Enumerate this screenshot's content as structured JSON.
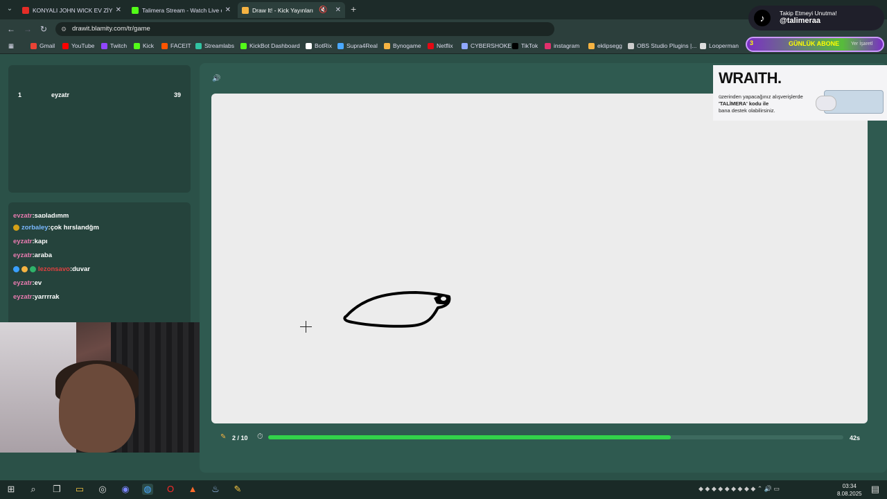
{
  "browser": {
    "tabs": [
      {
        "title": "KONYALI JOHN WICK EV ZİYARETİ",
        "favicon_color": "#e52d27"
      },
      {
        "title": "Talimera Stream - Watch Live on Kick",
        "favicon_color": "#53fc18"
      },
      {
        "title": "Draw It! - Kick Yayınları İçin",
        "favicon_color": "#f5b342"
      }
    ],
    "new_tab": "+",
    "url": "drawit.blamity.com/tr/game",
    "bookmarks": [
      {
        "label": "Gmail",
        "color": "#ea4335"
      },
      {
        "label": "YouTube",
        "color": "#ff0000"
      },
      {
        "label": "Twitch",
        "color": "#9146ff"
      },
      {
        "label": "Kick",
        "color": "#53fc18"
      },
      {
        "label": "FACEIT",
        "color": "#ff5500"
      },
      {
        "label": "Streamlabs",
        "color": "#31c3a2"
      },
      {
        "label": "KickBot Dashboard",
        "color": "#53fc18"
      },
      {
        "label": "BotRix",
        "color": "#ffffff"
      },
      {
        "label": "Supra4Real",
        "color": "#4aa8ff"
      },
      {
        "label": "Bynogame",
        "color": "#f5b342"
      },
      {
        "label": "Netflix",
        "color": "#e50914"
      },
      {
        "label": "CYBERSHOKE",
        "color": "#8fa8ff"
      },
      {
        "label": "TikTok",
        "color": "#000000"
      },
      {
        "label": "instagram",
        "color": "#e1306c"
      },
      {
        "label": "eklipsegg",
        "color": "#f5b342"
      },
      {
        "label": "OBS Studio Plugins |...",
        "color": "#cccccc"
      },
      {
        "label": "Looperman",
        "color": "#dddddd"
      }
    ]
  },
  "overlay": {
    "tiktok_line1": "Takip Etmeyi Unutma!",
    "tiktok_line2": "@talimeraa",
    "abone_count": "3",
    "abone_label": "GÜNLÜK ABONE",
    "abone_sub": "Yer İşaretl"
  },
  "leaderboard": {
    "rows": [
      {
        "rank": "1",
        "name": "eyzatr",
        "score": "39"
      }
    ]
  },
  "chat": {
    "lines": [
      {
        "user": "eyzatr",
        "msg": ":sapladımm",
        "cls": "u"
      },
      {
        "user": "zorbaley",
        "msg": ":çok hırslandğm",
        "cls": "u2"
      },
      {
        "user": "eyzatr",
        "msg": ":kapı",
        "cls": "u"
      },
      {
        "user": "eyzatr",
        "msg": ":araba",
        "cls": "u"
      },
      {
        "user": "lezonsavo",
        "msg": ":duvar",
        "cls": "u3"
      },
      {
        "user": "eyzatr",
        "msg": ":ev",
        "cls": "u"
      },
      {
        "user": "eyzatr",
        "msg": ":yarrrrak",
        "cls": "u"
      }
    ]
  },
  "game": {
    "round": "2 / 10",
    "time_left": "42s",
    "progress": 0.7,
    "progress_color": "#32d24a"
  },
  "ad": {
    "brand": "WRAITH.",
    "line1": "üzerinden yapacağınız alışverişlerde",
    "line2": "'TALİMERA' kodu ile",
    "line3": "bana destek olabilirsiniz."
  },
  "taskbar": {
    "time": "03:34",
    "date": "8.08.2025"
  }
}
